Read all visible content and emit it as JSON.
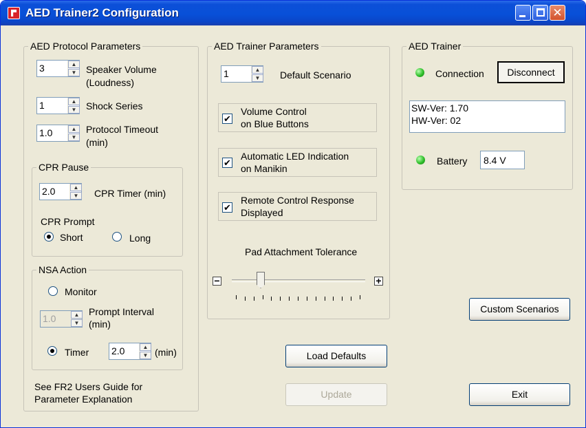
{
  "window": {
    "title": "AED Trainer2 Configuration"
  },
  "protocol": {
    "legend": "AED Protocol Parameters",
    "speaker_volume": {
      "value": "3",
      "label_line1": "Speaker Volume",
      "label_line2": "(Loudness)"
    },
    "shock_series": {
      "value": "1",
      "label": "Shock Series"
    },
    "protocol_timeout": {
      "value": "1.0",
      "label_line1": "Protocol Timeout",
      "label_line2": "(min)"
    },
    "cpr_pause": {
      "legend": "CPR Pause",
      "timer_value": "2.0",
      "timer_label": "CPR Timer (min)",
      "prompt_label": "CPR Prompt",
      "short_label": "Short",
      "long_label": "Long",
      "selected": "Short"
    },
    "nsa_action": {
      "legend": "NSA Action",
      "monitor_label": "Monitor",
      "prompt_interval_value": "1.0",
      "prompt_interval_label_line1": "Prompt Interval",
      "prompt_interval_label_line2": "(min)",
      "timer_label": "Timer",
      "timer_value": "2.0",
      "timer_unit": "(min)",
      "selected": "Timer"
    },
    "note_line1": "See FR2 Users Guide for",
    "note_line2": "Parameter Explanation"
  },
  "trainer_params": {
    "legend": "AED Trainer Parameters",
    "default_scenario": {
      "value": "1",
      "label": "Default Scenario"
    },
    "volume_control": {
      "checked": true,
      "label_line1": "Volume Control",
      "label_line2": "on Blue Buttons"
    },
    "auto_led": {
      "checked": true,
      "label_line1": "Automatic LED Indication",
      "label_line2": "on Manikin"
    },
    "remote_control": {
      "checked": true,
      "label_line1": "Remote Control Response",
      "label_line2": "Displayed"
    },
    "pad_tolerance": {
      "label": "Pad Attachment Tolerance",
      "minus": "−",
      "plus": "+",
      "level": 0.2,
      "ticks": 15
    }
  },
  "trainer": {
    "legend": "AED Trainer",
    "connection_label": "Connection",
    "disconnect_label": "Disconnect",
    "sw_ver": "SW-Ver: 1.70",
    "hw_ver": "HW-Ver: 02",
    "battery_label": "Battery",
    "battery_value": "8.4 V",
    "led_color": "#2fbf2a"
  },
  "buttons": {
    "custom_scenarios": "Custom Scenarios",
    "load_defaults": "Load Defaults",
    "update": "Update",
    "exit": "Exit"
  },
  "colors": {
    "titlebar": "#0850d8",
    "window_bg": "#ece9d8",
    "close_btn": "#d3522d"
  }
}
